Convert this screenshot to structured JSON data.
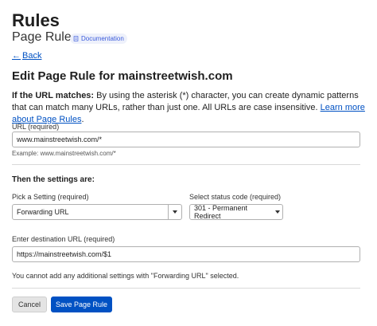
{
  "header": {
    "title": "Rules",
    "subtitle": "Page Rules",
    "doc_badge": "Documentation",
    "back_label": "Back"
  },
  "page": {
    "heading": "Edit Page Rule for mainstreetwish.com",
    "intro_bold": "If the URL matches:",
    "intro_text": " By using the asterisk (*) character, you can create dynamic patterns that can match many URLs, rather than just one. All URLs are case insensitive. ",
    "intro_link": "Learn more about Page Rules",
    "intro_end": "."
  },
  "url_field": {
    "label": "URL (required)",
    "value": "www.mainstreetwish.com/*",
    "example": "Example: www.mainstreetwish.com/*"
  },
  "settings": {
    "heading": "Then the settings are:",
    "setting_label": "Pick a Setting (required)",
    "setting_value": "Forwarding URL",
    "status_label": "Select status code (required)",
    "status_value": "301 - Permanent Redirect",
    "destination_label": "Enter destination URL (required)",
    "destination_value": "https://mainstreetwish.com/$1",
    "note": "You cannot add any additional settings with \"Forwarding URL\" selected."
  },
  "actions": {
    "cancel_label": "Cancel",
    "save_label": "Save Page Rule"
  },
  "colors": {
    "link": "#0051c3",
    "primary_button": "#0051c3",
    "badge_bg": "#eef1fb"
  }
}
